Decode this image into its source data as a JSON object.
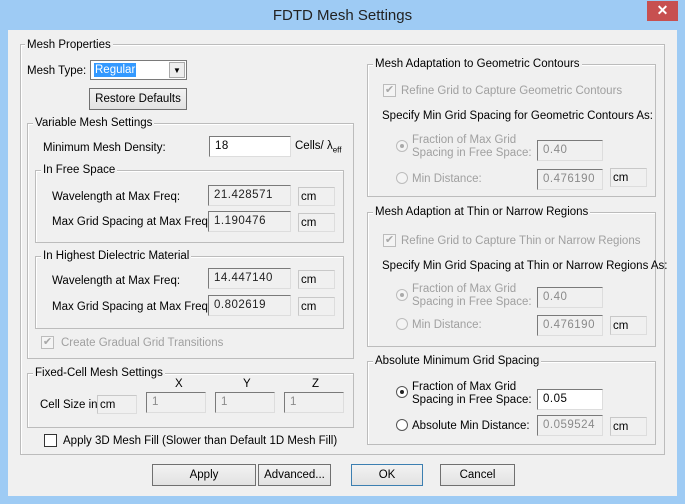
{
  "window": {
    "title": "FDTD Mesh Settings",
    "close_icon": "close-icon"
  },
  "mesh_properties": {
    "label": "Mesh Properties",
    "mesh_type_label": "Mesh Type:",
    "mesh_type_value": "Regular",
    "restore_defaults": "Restore Defaults",
    "variable": {
      "label": "Variable Mesh Settings",
      "min_density_label": "Minimum Mesh Density:",
      "min_density_value": "18",
      "min_density_unit": "Cells/ λ",
      "min_density_unit_sub": "eff",
      "free_space": {
        "label": "In Free Space",
        "wavelength_label": "Wavelength at Max Freq:",
        "wavelength_value": "21.428571",
        "wavelength_unit": "cm",
        "spacing_label": "Max Grid Spacing at Max Freq:",
        "spacing_value": "1.190476",
        "spacing_unit": "cm"
      },
      "dielectric": {
        "label": "In Highest Dielectric Material",
        "wavelength_label": "Wavelength at Max Freq:",
        "wavelength_value": "14.447140",
        "wavelength_unit": "cm",
        "spacing_label": "Max Grid Spacing at Max Freq:",
        "spacing_value": "0.802619",
        "spacing_unit": "cm"
      },
      "gradual_label": "Create Gradual Grid Transitions",
      "gradual_checked": true
    },
    "fixed": {
      "label": "Fixed-Cell Mesh Settings",
      "x": "X",
      "y": "Y",
      "z": "Z",
      "cell_size_label": "Cell Size in",
      "unit": "cm",
      "x_value": "1",
      "y_value": "1",
      "z_value": "1"
    },
    "mesh_fill_label": "Apply 3D Mesh Fill (Slower than Default 1D Mesh Fill)",
    "mesh_fill_checked": false,
    "contours": {
      "label": "Mesh Adaptation to Geometric Contours",
      "refine_label": "Refine Grid to Capture Geometric Contours",
      "refine_checked": true,
      "specify_label": "Specify Min Grid Spacing for Geometric Contours As:",
      "fraction_label_1": "Fraction of Max Grid",
      "fraction_label_2": "Spacing in Free Space:",
      "fraction_value": "0.40",
      "min_distance_label": "Min Distance:",
      "min_distance_value": "0.476190",
      "unit": "cm"
    },
    "thin": {
      "label": "Mesh Adaption at Thin or Narrow Regions",
      "refine_label": "Refine Grid to Capture Thin or Narrow Regions",
      "refine_checked": true,
      "specify_label": "Specify Min Grid Spacing at Thin or Narrow Regions As:",
      "fraction_label_1": "Fraction of Max Grid",
      "fraction_label_2": "Spacing in Free Space:",
      "fraction_value": "0.40",
      "min_distance_label": "Min Distance:",
      "min_distance_value": "0.476190",
      "unit": "cm"
    },
    "absolute": {
      "label": "Absolute Minimum Grid Spacing",
      "fraction_label_1": "Fraction of Max Grid",
      "fraction_label_2": "Spacing in Free Space:",
      "fraction_value": "0.05",
      "min_distance_label": "Absolute Min Distance:",
      "min_distance_value": "0.059524",
      "unit": "cm"
    }
  },
  "buttons": {
    "apply": "Apply",
    "advanced": "Advanced...",
    "ok": "OK",
    "cancel": "Cancel"
  }
}
